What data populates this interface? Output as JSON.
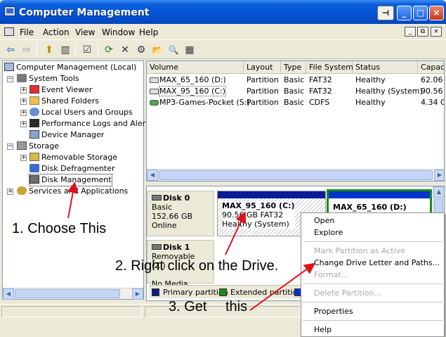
{
  "window": {
    "title": "Computer Management",
    "title_buttons": {
      "pin": "⊣",
      "minimize": "_",
      "maximize": "□",
      "close": "×"
    }
  },
  "menubar": {
    "items": [
      "File",
      "Action",
      "View",
      "Window",
      "Help"
    ],
    "mdi_buttons": {
      "minimize": "_",
      "restore": "⧉",
      "close": "×"
    }
  },
  "toolbar": {
    "icons": [
      "back-icon",
      "forward-icon",
      "up-folder-icon",
      "show-hide-tree-icon",
      "properties-icon",
      "refresh-icon",
      "delete-icon",
      "settings-icon",
      "open-icon",
      "search-icon",
      "help-icon"
    ],
    "glyphs": {
      "back": "⇦",
      "forward": "⇨",
      "up": "⬆",
      "tree": "▥",
      "properties": "☑",
      "refresh": "⟳",
      "delete": "✕",
      "settings": "⚙",
      "open": "📂",
      "search": "🔍",
      "help": "▦"
    }
  },
  "tree": {
    "root": "Computer Management (Local)",
    "system_tools": "System Tools",
    "event_viewer": "Event Viewer",
    "shared_folders": "Shared Folders",
    "local_users": "Local Users and Groups",
    "perf_logs": "Performance Logs and Alerts",
    "device_manager": "Device Manager",
    "storage": "Storage",
    "removable_storage": "Removable Storage",
    "disk_defrag": "Disk Defragmenter",
    "disk_management": "Disk Management",
    "services": "Services and Applications"
  },
  "volume_list": {
    "columns": [
      "Volume",
      "Layout",
      "Type",
      "File System",
      "Status",
      "Capaci"
    ],
    "rows": [
      {
        "volume": "MAX_65_160 (D:)",
        "layout": "Partition",
        "type": "Basic",
        "fs": "FAT32",
        "status": "Healthy",
        "capacity": "62.06"
      },
      {
        "volume": "MAX_95_160 (C:)",
        "layout": "Partition",
        "type": "Basic",
        "fs": "FAT32",
        "status": "Healthy (System)",
        "capacity": "90.56"
      },
      {
        "volume": "MP3-Games-Pocket (S:)",
        "layout": "Partition",
        "type": "Basic",
        "fs": "CDFS",
        "status": "Healthy",
        "capacity": "4.34 G"
      }
    ]
  },
  "disks": {
    "disk0": {
      "name": "Disk 0",
      "type": "Basic",
      "size": "152.66 GB",
      "state": "Online"
    },
    "disk0_partitions": [
      {
        "name": "MAX_95_160 (C:)",
        "size": "90.56 GB FAT32",
        "status": "Healthy (System)"
      },
      {
        "name": "MAX_65_160 (D:)"
      }
    ],
    "disk1": {
      "name": "Disk 1",
      "type": "Removable (Z:)",
      "state": "No Media"
    }
  },
  "legend": {
    "primary": "Primary partition",
    "extended": "Extended partition",
    "colors": {
      "primary": "#0a1b96",
      "extended": "#1a8a1a",
      "logical": "#0033cc"
    }
  },
  "context_menu": {
    "open": "Open",
    "explore": "Explore",
    "mark_active": "Mark Partition as Active",
    "change_letter": "Change Drive Letter and Paths...",
    "format": "Format...",
    "delete": "Delete Partition...",
    "properties": "Properties",
    "help": "Help"
  },
  "annotations": {
    "step1": "1. Choose This",
    "step2": "2. Right click on the Drive.",
    "step3_a": "3. Get",
    "step3_b": "this"
  },
  "colors": {
    "titlebar": "#0553d2",
    "annotation_arrow": "#e0101a",
    "selection_border": "#0a1b96"
  }
}
